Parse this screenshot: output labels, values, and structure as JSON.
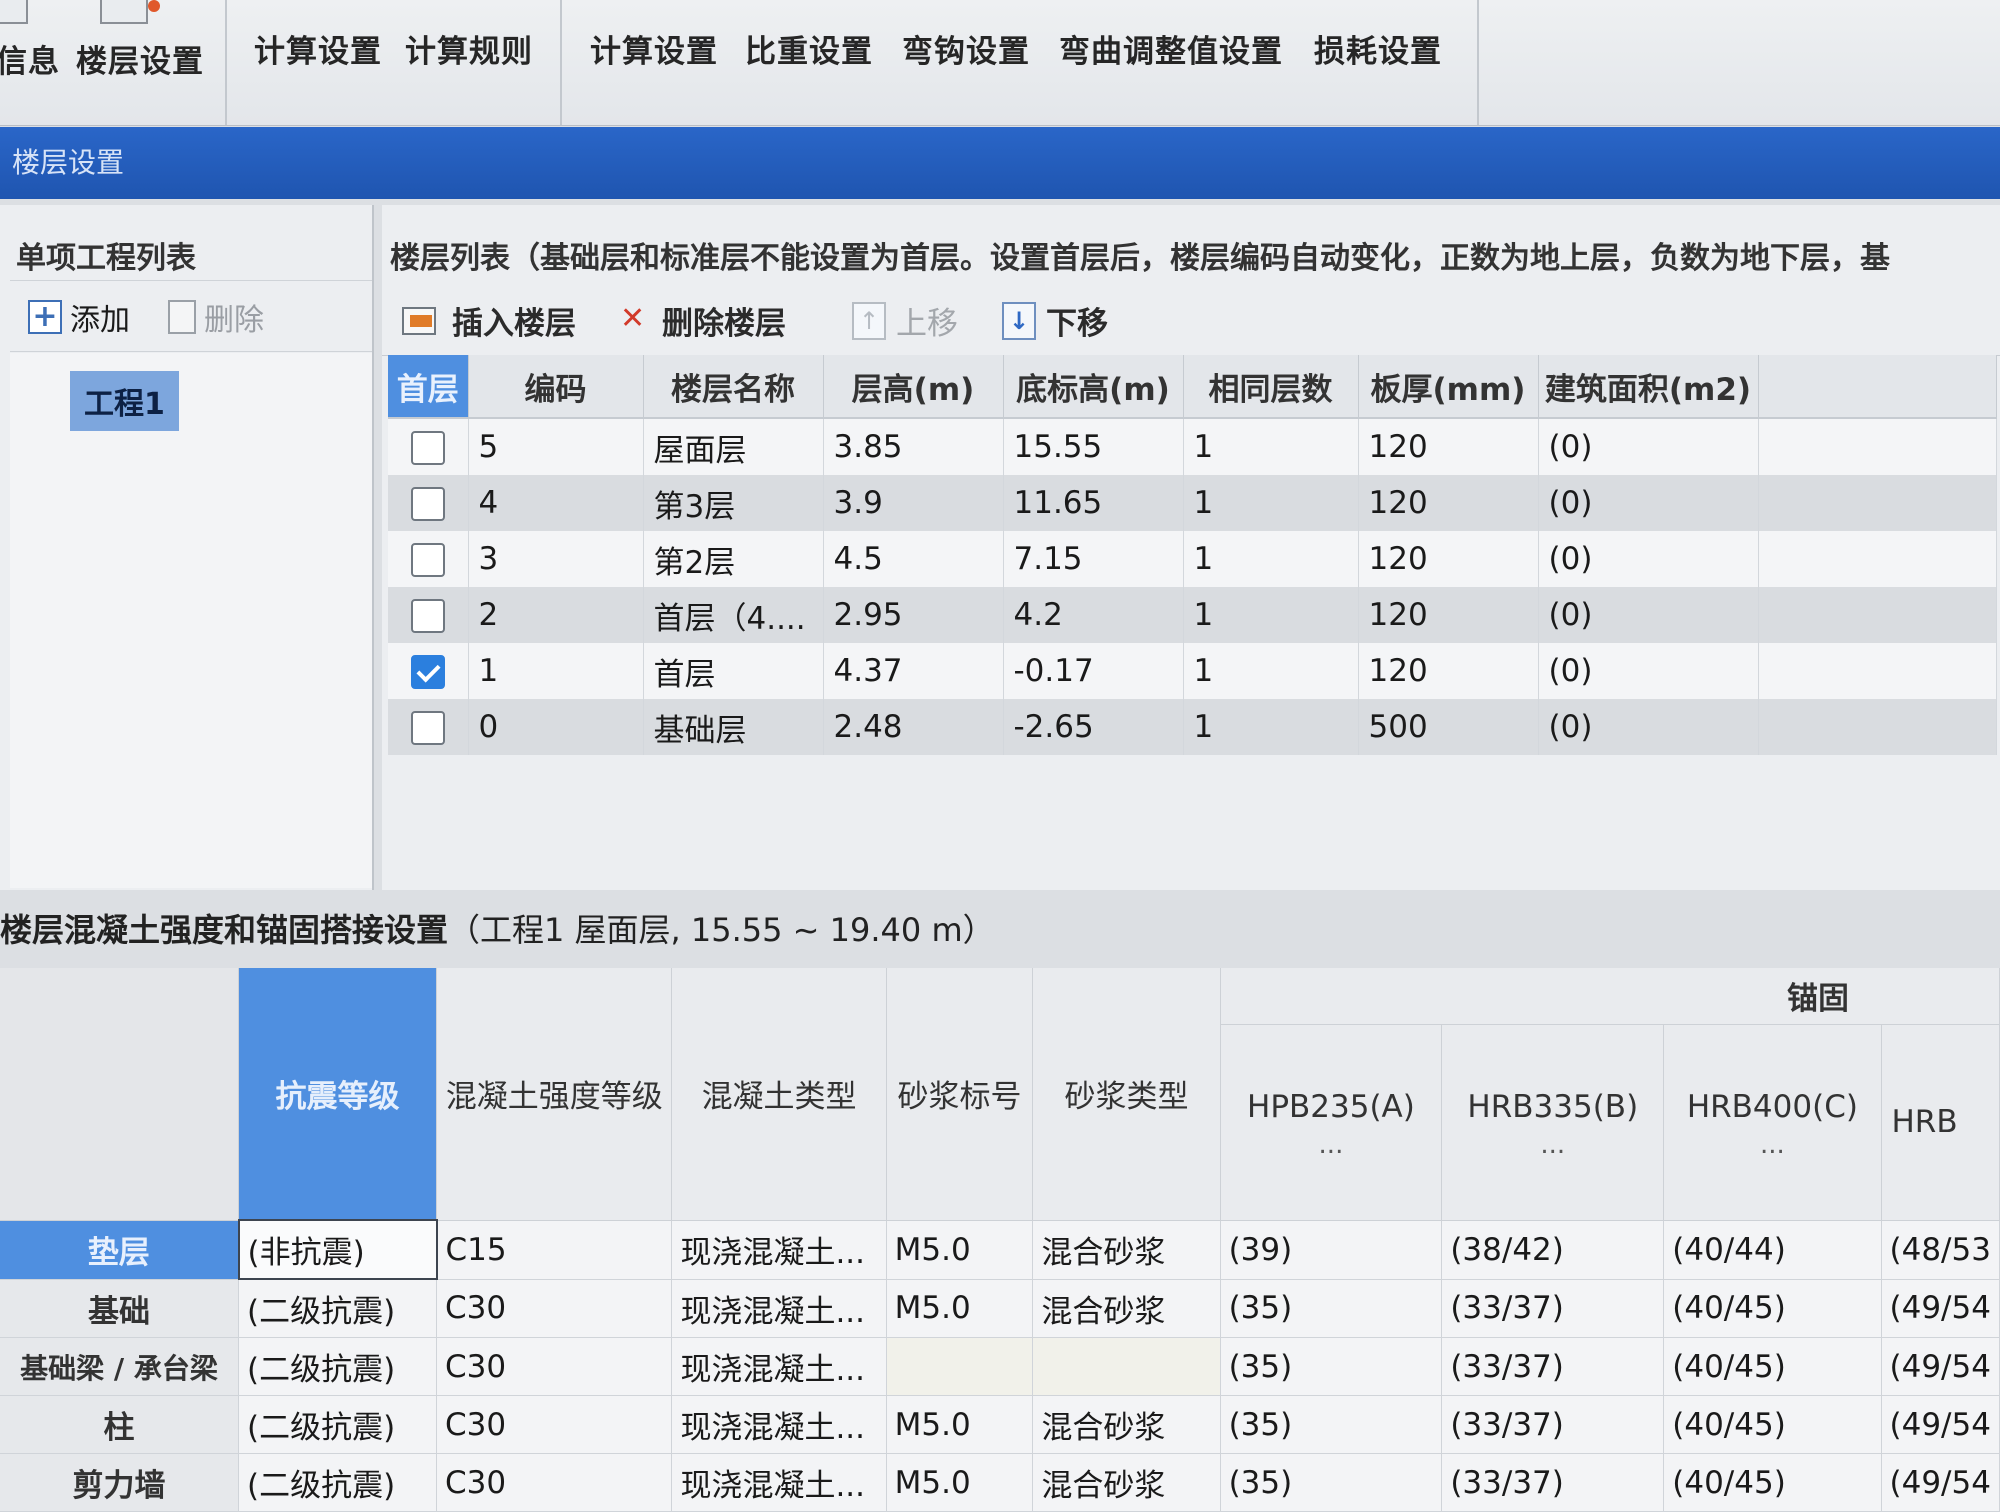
{
  "ribbon": {
    "groups": [
      {
        "items": [
          "信息",
          "楼层设置"
        ]
      },
      {
        "items": [
          "计算设置",
          "计算规则"
        ]
      },
      {
        "items": [
          "计算设置",
          "比重设置",
          "弯钩设置",
          "弯曲调整值设置",
          "损耗设置"
        ]
      }
    ]
  },
  "window_title": "楼层设置",
  "project_panel": {
    "title": "单项工程列表",
    "add_label": "添加",
    "delete_label": "删除",
    "items": [
      "工程1"
    ]
  },
  "floor_panel": {
    "note": "楼层列表（基础层和标准层不能设置为首层。设置首层后，楼层编码自动变化，正数为地上层，负数为地下层，基",
    "toolbar": {
      "insert": "插入楼层",
      "delete": "删除楼层",
      "up": "上移",
      "down": "下移"
    },
    "columns": [
      "首层",
      "编码",
      "楼层名称",
      "层高(m)",
      "底标高(m)",
      "相同层数",
      "板厚(mm)",
      "建筑面积(m2)"
    ],
    "rows": [
      {
        "first": false,
        "code": "5",
        "name": "屋面层",
        "height": "3.85",
        "base": "15.55",
        "same": "1",
        "slab": "120",
        "area": "(0)"
      },
      {
        "first": false,
        "code": "4",
        "name": "第3层",
        "height": "3.9",
        "base": "11.65",
        "same": "1",
        "slab": "120",
        "area": "(0)"
      },
      {
        "first": false,
        "code": "3",
        "name": "第2层",
        "height": "4.5",
        "base": "7.15",
        "same": "1",
        "slab": "120",
        "area": "(0)"
      },
      {
        "first": false,
        "code": "2",
        "name": "首层（4....",
        "height": "2.95",
        "base": "4.2",
        "same": "1",
        "slab": "120",
        "area": "(0)"
      },
      {
        "first": true,
        "code": "1",
        "name": "首层",
        "height": "4.37",
        "base": "-0.17",
        "same": "1",
        "slab": "120",
        "area": "(0)"
      },
      {
        "first": false,
        "code": "0",
        "name": "基础层",
        "height": "2.48",
        "base": "-2.65",
        "same": "1",
        "slab": "500",
        "area": "(0)"
      }
    ]
  },
  "concrete": {
    "title_bold": "楼层混凝土强度和锚固搭接设置",
    "title_rest": "（工程1  屋面层, 15.55 ~ 19.40 m）",
    "group_header": "锚固",
    "columns": [
      "抗震等级",
      "混凝土强度等级",
      "混凝土类型",
      "砂浆标号",
      "砂浆类型",
      "HPB235(A)",
      "HRB335(B)",
      "HRB400(C)",
      "HRB"
    ],
    "col_dots": "...",
    "rows": [
      {
        "name": "垫层",
        "seismic": "(非抗震)",
        "grade": "C15",
        "ctype": "现浇混凝土...",
        "mortar": "M5.0",
        "mtype": "混合砂浆",
        "a": "(39)",
        "b": "(38/42)",
        "c": "(40/44)",
        "d": "(48/53"
      },
      {
        "name": "基础",
        "seismic": "(二级抗震)",
        "grade": "C30",
        "ctype": "现浇混凝土...",
        "mortar": "M5.0",
        "mtype": "混合砂浆",
        "a": "(35)",
        "b": "(33/37)",
        "c": "(40/45)",
        "d": "(49/54"
      },
      {
        "name": "基础梁 / 承台梁",
        "seismic": "(二级抗震)",
        "grade": "C30",
        "ctype": "现浇混凝土...",
        "mortar": "",
        "mtype": "",
        "a": "(35)",
        "b": "(33/37)",
        "c": "(40/45)",
        "d": "(49/54"
      },
      {
        "name": "柱",
        "seismic": "(二级抗震)",
        "grade": "C30",
        "ctype": "现浇混凝土...",
        "mortar": "M5.0",
        "mtype": "混合砂浆",
        "a": "(35)",
        "b": "(33/37)",
        "c": "(40/45)",
        "d": "(49/54"
      },
      {
        "name": "剪力墙",
        "seismic": "(二级抗震)",
        "grade": "C30",
        "ctype": "现浇混凝土...",
        "mortar": "M5.0",
        "mtype": "混合砂浆",
        "a": "(35)",
        "b": "(33/37)",
        "c": "(40/45)",
        "d": "(49/54"
      }
    ]
  }
}
